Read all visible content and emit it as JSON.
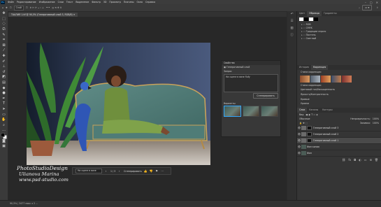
{
  "menu": {
    "items": [
      "Файл",
      "Редактирование",
      "Изображение",
      "Слои",
      "Текст",
      "Выделение",
      "Фильтр",
      "3D",
      "Просмотр",
      "Плагины",
      "Окно",
      "Справка"
    ]
  },
  "options": {
    "mode": "Слой"
  },
  "document": {
    "tab_title": "ТААЛИЯ 1.tif @ 90,5% (Генеративный слой 3, RGB/8)",
    "status": "90,5%  |  3477 пикс x 2 ... ",
    "zoom": "90,5%"
  },
  "context_bar": {
    "prompt_value": "На сцене в вазе",
    "generate_label": "Сгенерировать",
    "page": "1 / 3"
  },
  "gen_panel": {
    "title": "Свойства",
    "layer_label": "Генеративный слой",
    "prompt_heading": "Запрос",
    "prompt_text": "На сцене в вазе flufy",
    "generate_label": "Сгенерировать",
    "variants_label": "Варианты"
  },
  "right": {
    "top_tabs": [
      "Цвет",
      "Образцы",
      "Градиенты"
    ],
    "folders": [
      "RGB",
      "CMYK",
      "Градации серого",
      "Пастель",
      "Светлый"
    ],
    "mid_tabs": [
      "История",
      "Коррекция"
    ],
    "adjustments_heading": "Стили коррекции",
    "adjustments": [
      "Стили коррекции",
      "Цветовой тон/Насыщенность",
      "Яркость/Контрастность",
      "Кривые",
      "Уровни"
    ],
    "layer_tabs": [
      "Слои",
      "Каналы",
      "Контуры"
    ],
    "layer_filter": "Вид",
    "blend_mode": "Обычные",
    "opacity_label": "Непрозрачность:",
    "opacity_value": "100%",
    "fill_label": "Заливка:",
    "fill_value": "100%",
    "layers": [
      {
        "name": "Генеративный слой 3",
        "selected": false
      },
      {
        "name": "Генеративный слой 2",
        "selected": false
      },
      {
        "name": "Генеративный слой 1",
        "selected": true
      },
      {
        "name": "Фон копия",
        "selected": false
      },
      {
        "name": "Фон",
        "selected": false
      }
    ]
  },
  "watermark": {
    "line1": "PhotoStudioDesign",
    "line2": "Ulianova Marina",
    "line3": "www.psd-studio.com"
  },
  "colors": {
    "accent": "#31a8ff",
    "app_bg": "#2b2b2b"
  }
}
